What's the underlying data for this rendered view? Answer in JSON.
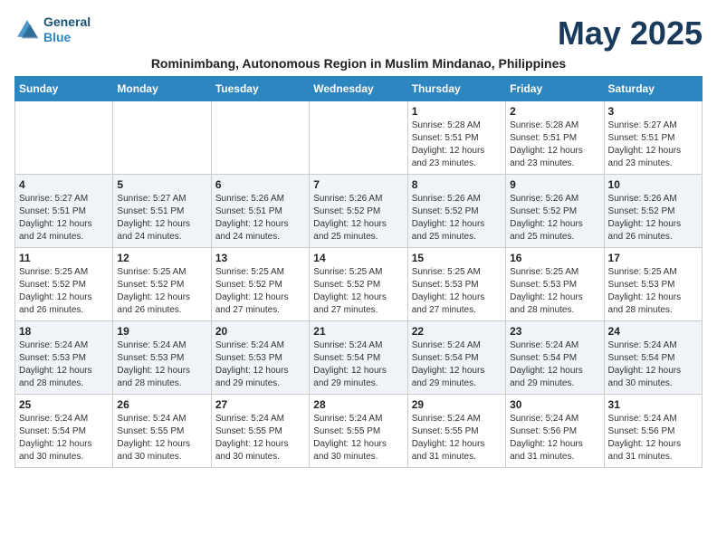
{
  "logo": {
    "line1": "General",
    "line2": "Blue"
  },
  "month_title": "May 2025",
  "subtitle": "Rominimbang, Autonomous Region in Muslim Mindanao, Philippines",
  "headers": [
    "Sunday",
    "Monday",
    "Tuesday",
    "Wednesday",
    "Thursday",
    "Friday",
    "Saturday"
  ],
  "weeks": [
    [
      {
        "day": "",
        "info": ""
      },
      {
        "day": "",
        "info": ""
      },
      {
        "day": "",
        "info": ""
      },
      {
        "day": "",
        "info": ""
      },
      {
        "day": "1",
        "info": "Sunrise: 5:28 AM\nSunset: 5:51 PM\nDaylight: 12 hours\nand 23 minutes."
      },
      {
        "day": "2",
        "info": "Sunrise: 5:28 AM\nSunset: 5:51 PM\nDaylight: 12 hours\nand 23 minutes."
      },
      {
        "day": "3",
        "info": "Sunrise: 5:27 AM\nSunset: 5:51 PM\nDaylight: 12 hours\nand 23 minutes."
      }
    ],
    [
      {
        "day": "4",
        "info": "Sunrise: 5:27 AM\nSunset: 5:51 PM\nDaylight: 12 hours\nand 24 minutes."
      },
      {
        "day": "5",
        "info": "Sunrise: 5:27 AM\nSunset: 5:51 PM\nDaylight: 12 hours\nand 24 minutes."
      },
      {
        "day": "6",
        "info": "Sunrise: 5:26 AM\nSunset: 5:51 PM\nDaylight: 12 hours\nand 24 minutes."
      },
      {
        "day": "7",
        "info": "Sunrise: 5:26 AM\nSunset: 5:52 PM\nDaylight: 12 hours\nand 25 minutes."
      },
      {
        "day": "8",
        "info": "Sunrise: 5:26 AM\nSunset: 5:52 PM\nDaylight: 12 hours\nand 25 minutes."
      },
      {
        "day": "9",
        "info": "Sunrise: 5:26 AM\nSunset: 5:52 PM\nDaylight: 12 hours\nand 25 minutes."
      },
      {
        "day": "10",
        "info": "Sunrise: 5:26 AM\nSunset: 5:52 PM\nDaylight: 12 hours\nand 26 minutes."
      }
    ],
    [
      {
        "day": "11",
        "info": "Sunrise: 5:25 AM\nSunset: 5:52 PM\nDaylight: 12 hours\nand 26 minutes."
      },
      {
        "day": "12",
        "info": "Sunrise: 5:25 AM\nSunset: 5:52 PM\nDaylight: 12 hours\nand 26 minutes."
      },
      {
        "day": "13",
        "info": "Sunrise: 5:25 AM\nSunset: 5:52 PM\nDaylight: 12 hours\nand 27 minutes."
      },
      {
        "day": "14",
        "info": "Sunrise: 5:25 AM\nSunset: 5:52 PM\nDaylight: 12 hours\nand 27 minutes."
      },
      {
        "day": "15",
        "info": "Sunrise: 5:25 AM\nSunset: 5:53 PM\nDaylight: 12 hours\nand 27 minutes."
      },
      {
        "day": "16",
        "info": "Sunrise: 5:25 AM\nSunset: 5:53 PM\nDaylight: 12 hours\nand 28 minutes."
      },
      {
        "day": "17",
        "info": "Sunrise: 5:25 AM\nSunset: 5:53 PM\nDaylight: 12 hours\nand 28 minutes."
      }
    ],
    [
      {
        "day": "18",
        "info": "Sunrise: 5:24 AM\nSunset: 5:53 PM\nDaylight: 12 hours\nand 28 minutes."
      },
      {
        "day": "19",
        "info": "Sunrise: 5:24 AM\nSunset: 5:53 PM\nDaylight: 12 hours\nand 28 minutes."
      },
      {
        "day": "20",
        "info": "Sunrise: 5:24 AM\nSunset: 5:53 PM\nDaylight: 12 hours\nand 29 minutes."
      },
      {
        "day": "21",
        "info": "Sunrise: 5:24 AM\nSunset: 5:54 PM\nDaylight: 12 hours\nand 29 minutes."
      },
      {
        "day": "22",
        "info": "Sunrise: 5:24 AM\nSunset: 5:54 PM\nDaylight: 12 hours\nand 29 minutes."
      },
      {
        "day": "23",
        "info": "Sunrise: 5:24 AM\nSunset: 5:54 PM\nDaylight: 12 hours\nand 29 minutes."
      },
      {
        "day": "24",
        "info": "Sunrise: 5:24 AM\nSunset: 5:54 PM\nDaylight: 12 hours\nand 30 minutes."
      }
    ],
    [
      {
        "day": "25",
        "info": "Sunrise: 5:24 AM\nSunset: 5:54 PM\nDaylight: 12 hours\nand 30 minutes."
      },
      {
        "day": "26",
        "info": "Sunrise: 5:24 AM\nSunset: 5:55 PM\nDaylight: 12 hours\nand 30 minutes."
      },
      {
        "day": "27",
        "info": "Sunrise: 5:24 AM\nSunset: 5:55 PM\nDaylight: 12 hours\nand 30 minutes."
      },
      {
        "day": "28",
        "info": "Sunrise: 5:24 AM\nSunset: 5:55 PM\nDaylight: 12 hours\nand 30 minutes."
      },
      {
        "day": "29",
        "info": "Sunrise: 5:24 AM\nSunset: 5:55 PM\nDaylight: 12 hours\nand 31 minutes."
      },
      {
        "day": "30",
        "info": "Sunrise: 5:24 AM\nSunset: 5:56 PM\nDaylight: 12 hours\nand 31 minutes."
      },
      {
        "day": "31",
        "info": "Sunrise: 5:24 AM\nSunset: 5:56 PM\nDaylight: 12 hours\nand 31 minutes."
      }
    ]
  ]
}
